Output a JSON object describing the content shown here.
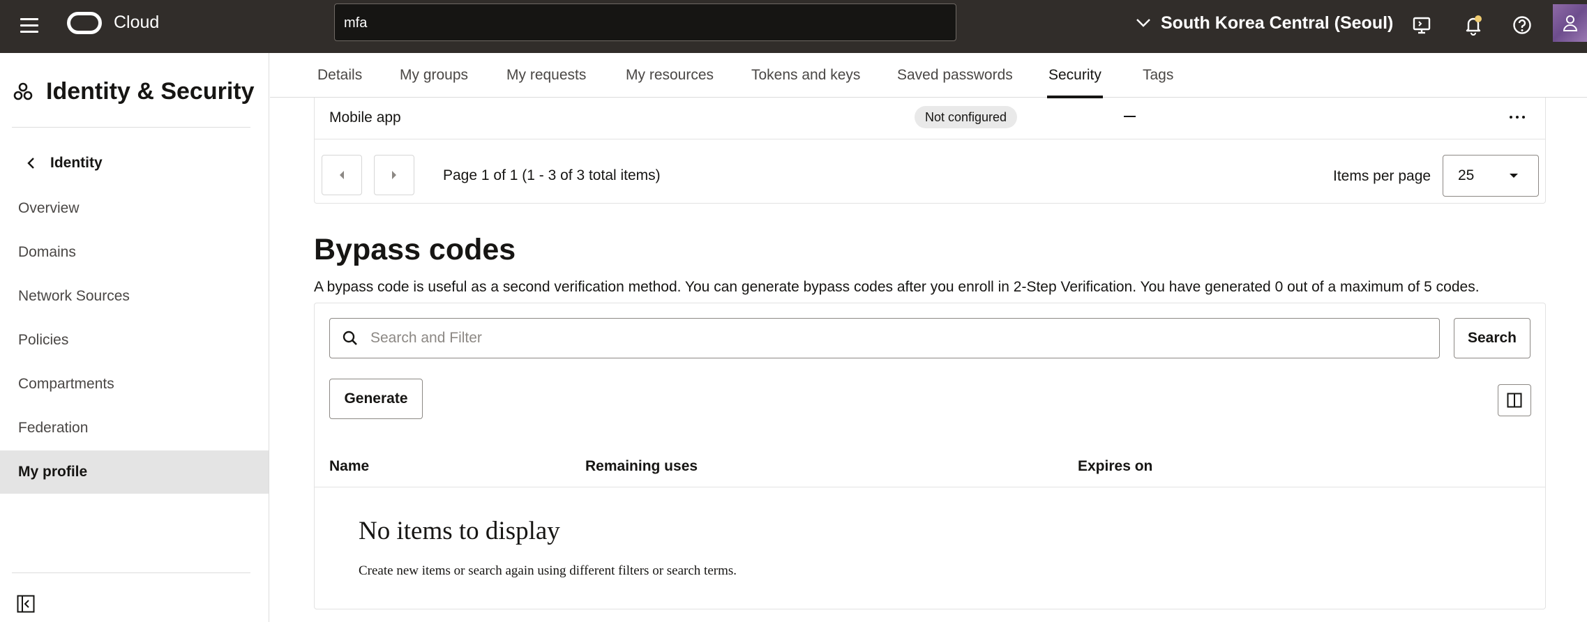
{
  "header": {
    "brand": "Cloud",
    "search_value": "mfa",
    "region": "South Korea Central (Seoul)"
  },
  "sidebar": {
    "title": "Identity & Security",
    "back_label": "Identity",
    "items": [
      {
        "label": "Overview"
      },
      {
        "label": "Domains"
      },
      {
        "label": "Network Sources"
      },
      {
        "label": "Policies"
      },
      {
        "label": "Compartments"
      },
      {
        "label": "Federation"
      },
      {
        "label": "My profile"
      }
    ],
    "active_item": "My profile"
  },
  "tabs": [
    {
      "label": "Details"
    },
    {
      "label": "My groups"
    },
    {
      "label": "My requests"
    },
    {
      "label": "My resources"
    },
    {
      "label": "Tokens and keys"
    },
    {
      "label": "Saved passwords"
    },
    {
      "label": "Security"
    },
    {
      "label": "Tags"
    }
  ],
  "active_tab": "Security",
  "mfa_table": {
    "row": {
      "method": "Mobile app",
      "status": "Not configured",
      "value": "—"
    },
    "pagination": {
      "text": "Page 1 of 1 (1 - 3 of 3 total items)"
    },
    "items_per_page_label": "Items per page",
    "items_per_page_value": "25"
  },
  "bypass_codes": {
    "title": "Bypass codes",
    "description": "A bypass code is useful as a second verification method. You can generate bypass codes after you enroll in 2-Step Verification. You have generated 0 out of a maximum of 5 codes.",
    "search_placeholder": "Search and Filter",
    "search_button": "Search",
    "generate_button": "Generate",
    "columns": [
      "Name",
      "Remaining uses",
      "Expires on"
    ],
    "empty_title": "No items to display",
    "empty_subtitle": "Create new items or search again using different filters or search terms."
  },
  "colors": {
    "topbar_bg": "#312d2a",
    "badge_bg": "#e9e9e9",
    "notification_dot": "#f0cc71"
  }
}
